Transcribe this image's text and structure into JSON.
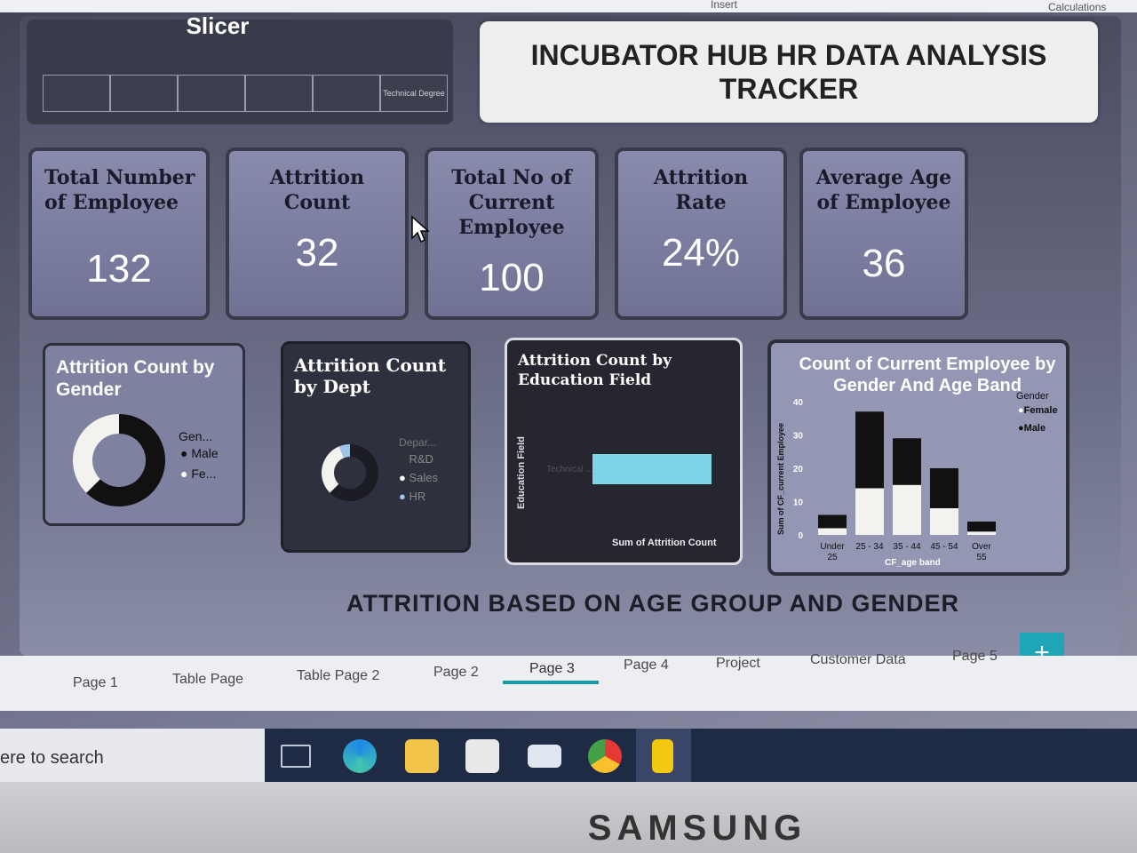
{
  "ribbon": {
    "insert": "Insert",
    "calculations": "Calculations"
  },
  "slicer": {
    "title": "Slicer",
    "options": [
      "",
      "",
      "",
      "",
      "",
      "Technical Degree"
    ]
  },
  "report_title": "INCUBATOR HUB HR DATA ANALYSIS TRACKER",
  "kpis": [
    {
      "label": "Total Number of Employee",
      "value": "132"
    },
    {
      "label": "Attrition Count",
      "value": "32"
    },
    {
      "label": "Total No of Current Employee",
      "value": "100"
    },
    {
      "label": "Attrition Rate",
      "value": "24%"
    },
    {
      "label": "Average Age of Employee",
      "value": "36"
    }
  ],
  "gender_card": {
    "title": "Attrition Count by Gender",
    "legend_title": "Gen...",
    "legend": [
      "Male",
      "Fe..."
    ]
  },
  "dept_card": {
    "title": "Attrition Count by Dept",
    "legend_title": "Depar...",
    "legend": [
      "R&D",
      "Sales",
      "HR"
    ]
  },
  "edu_card": {
    "title": "Attrition Count by Education Field",
    "ylabel": "Education Field",
    "xlabel": "Sum of Attrition Count",
    "category": "Technical ..."
  },
  "age_card": {
    "title": "Count of Current Employee by Gender And Age Band",
    "ylabel": "Sum of CF_current Employee",
    "xlabel": "CF_age band",
    "legend_title": "Gender",
    "legend": [
      "Female",
      "Male"
    ]
  },
  "footer_title": "ATTRITION BASED ON AGE GROUP AND GENDER",
  "tabs": [
    "Page 1",
    "Table Page",
    "Table Page 2",
    "Page 2",
    "Page 3",
    "Page 4",
    "Project",
    "Customer Data",
    "Page 5"
  ],
  "add_page": "+",
  "taskbar": {
    "search_placeholder": "ere to search"
  },
  "brand": "SAMSUNG",
  "colors": {
    "accent": "#1ea6b8",
    "male": "#111111",
    "female": "#f2f2ee",
    "edu_bar": "#7fd3e8",
    "hr": "#9ec6e8"
  },
  "chart_data": [
    {
      "type": "pie",
      "title": "Attrition Count by Gender",
      "categories": [
        "Male",
        "Fe..."
      ],
      "values": [
        20,
        12
      ],
      "legend": "right"
    },
    {
      "type": "pie",
      "title": "Attrition Count by Dept",
      "categories": [
        "R&D",
        "Sales",
        "HR"
      ],
      "values": [
        20,
        10,
        2
      ],
      "legend": "right"
    },
    {
      "type": "bar",
      "title": "Attrition Count by Education Field",
      "categories": [
        "Technical ..."
      ],
      "values": [
        32
      ],
      "xlabel": "Sum of Attrition Count",
      "ylabel": "Education Field"
    },
    {
      "type": "bar",
      "title": "Count of Current Employee by Gender And Age Band",
      "categories": [
        "Under 25",
        "25 - 34",
        "35 - 44",
        "45 - 54",
        "Over 55"
      ],
      "series": [
        {
          "name": "Female",
          "values": [
            2,
            14,
            15,
            8,
            1
          ]
        },
        {
          "name": "Male",
          "values": [
            4,
            23,
            14,
            12,
            3
          ]
        }
      ],
      "ylim": [
        0,
        40
      ],
      "yticks": [
        0,
        10,
        20,
        30,
        40
      ],
      "xlabel": "CF_age band",
      "ylabel": "Sum of CF_current Employee",
      "legend": "top-right"
    }
  ]
}
